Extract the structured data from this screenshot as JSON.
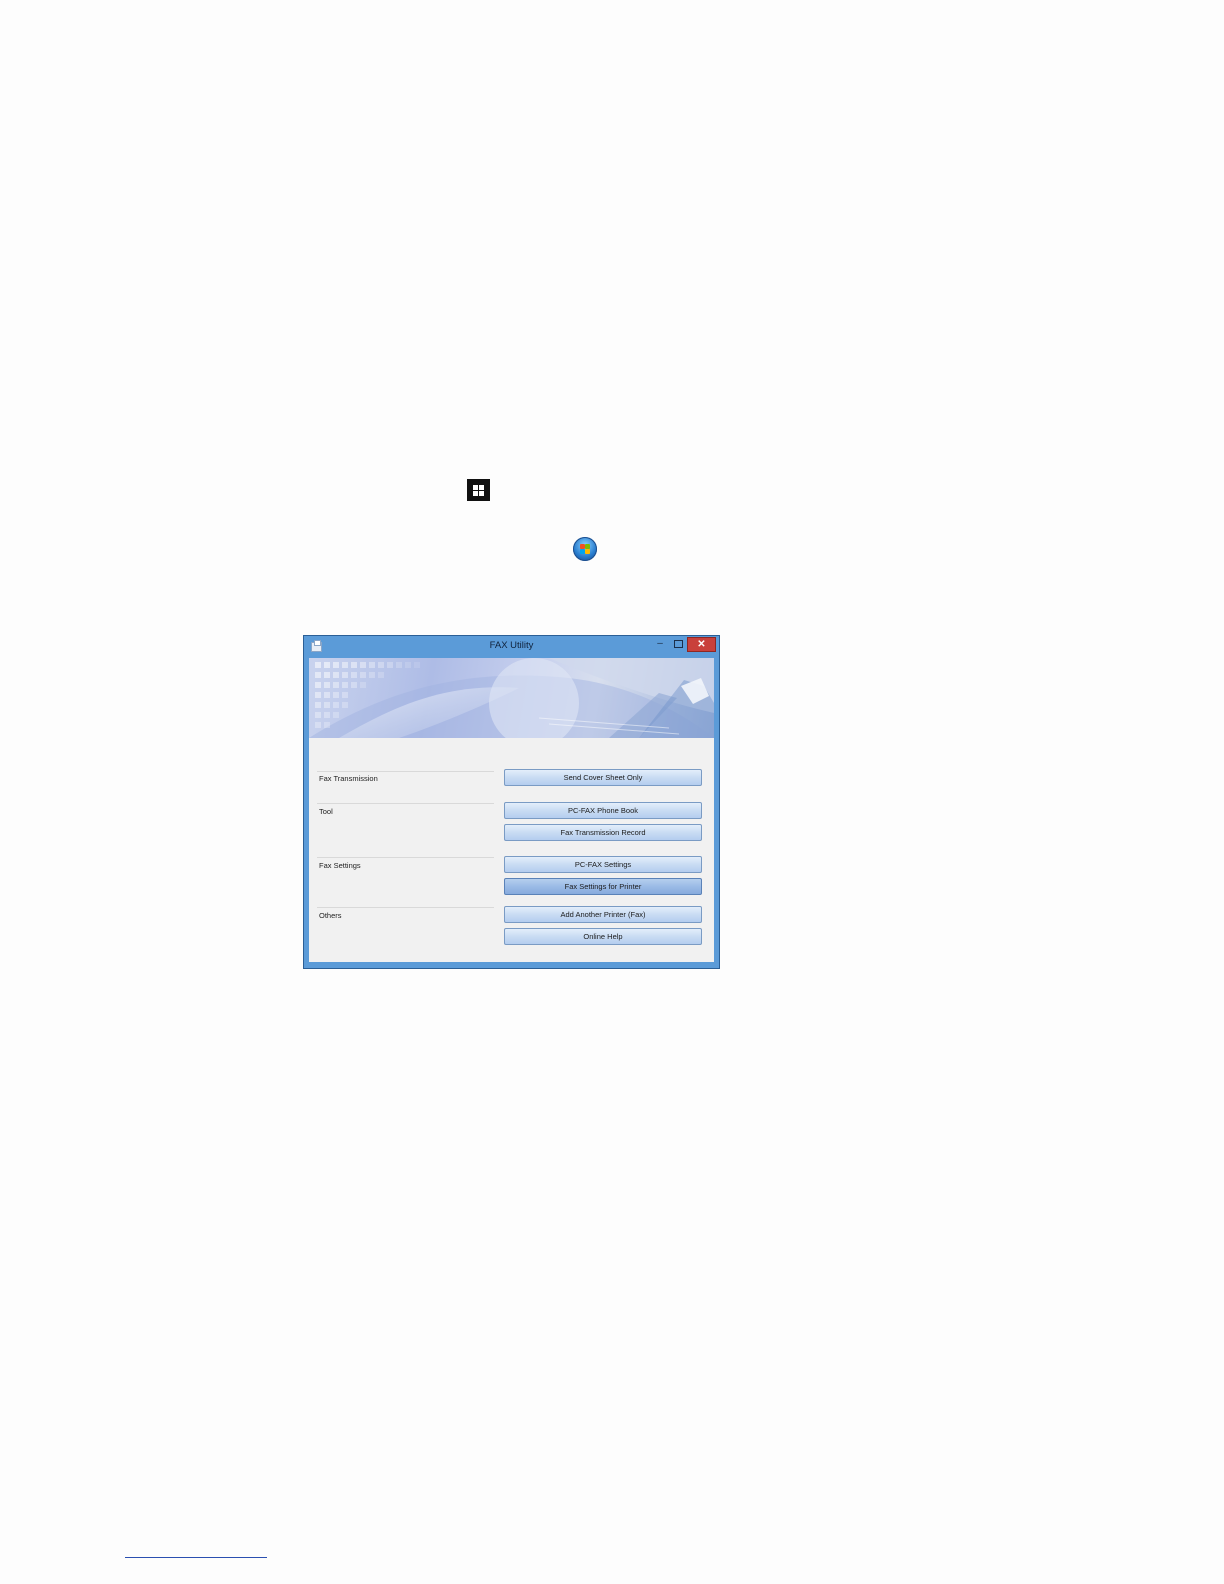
{
  "icons": {
    "windows8_start": "windows-8-start-icon",
    "windows7_start": "windows-7-start-orb-icon"
  },
  "window": {
    "title": "FAX Utility",
    "controls": {
      "minimize": "–",
      "close": "✕"
    },
    "sections": [
      {
        "label": "Fax Transmission",
        "buttons": [
          "Send Cover Sheet Only"
        ]
      },
      {
        "label": "Tool",
        "buttons": [
          "PC-FAX Phone Book",
          "Fax Transmission Record"
        ]
      },
      {
        "label": "Fax Settings",
        "buttons": [
          "PC-FAX Settings",
          "Fax Settings for Printer"
        ]
      },
      {
        "label": "Others",
        "buttons": [
          "Add Another Printer (Fax)",
          "Online Help"
        ]
      }
    ]
  },
  "colors": {
    "window_frame": "#5b9bd8",
    "close_button": "#c9403b",
    "button_face": "#c9dcf3"
  }
}
